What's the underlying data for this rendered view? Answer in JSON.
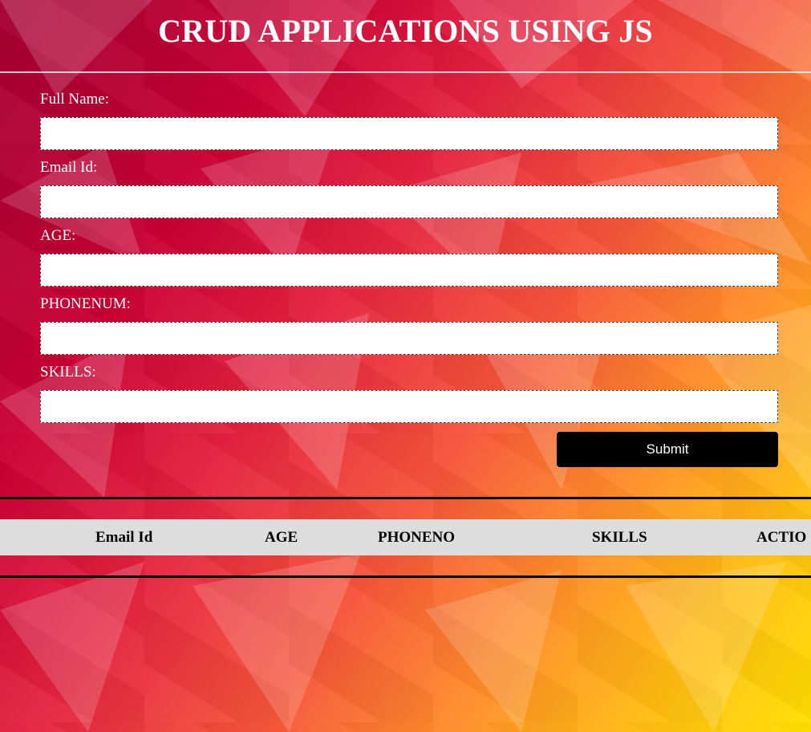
{
  "header": {
    "title": "CRUD APPLICATIONS USING JS"
  },
  "form": {
    "fields": [
      {
        "label": "Full Name:",
        "value": "",
        "placeholder": ""
      },
      {
        "label": "Email Id:",
        "value": "",
        "placeholder": ""
      },
      {
        "label": "AGE:",
        "value": "",
        "placeholder": ""
      },
      {
        "label": "PHONENUM:",
        "value": "",
        "placeholder": ""
      },
      {
        "label": "SKILLS:",
        "value": "",
        "placeholder": ""
      }
    ],
    "submit_label": "Submit"
  },
  "table": {
    "columns": [
      "Email Id",
      "AGE",
      "PHONENO",
      "SKILLS",
      "ACTIO"
    ]
  },
  "colors": {
    "title_text": "#ffffff",
    "button_background": "#000000",
    "table_header_background": "#dddddd",
    "gradient_start": "#a30034",
    "gradient_end": "#ffe000"
  }
}
